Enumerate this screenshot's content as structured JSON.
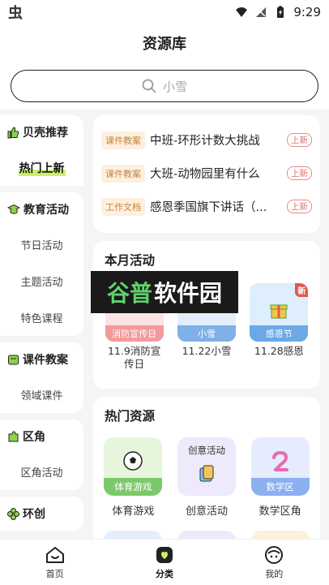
{
  "status_bar": {
    "app_glyph": "虫",
    "time": "9:29",
    "icons": [
      "wifi-icon",
      "signal-icon",
      "battery-icon"
    ]
  },
  "header": {
    "title": "资源库"
  },
  "search": {
    "placeholder": "小雪"
  },
  "sidebar": {
    "groups": [
      {
        "title": "贝壳推荐",
        "icon": "thumbs-up-icon",
        "items": [
          "热门上新"
        ],
        "active_index": 0
      },
      {
        "title": "教育活动",
        "icon": "graduation-cap-icon",
        "items": [
          "节日活动",
          "主题活动",
          "特色课程"
        ]
      },
      {
        "title": "课件教案",
        "icon": "courseware-icon",
        "items": [
          "领域课件"
        ]
      },
      {
        "title": "区角",
        "icon": "puzzle-icon",
        "items": [
          "区角活动"
        ]
      },
      {
        "title": "环创",
        "icon": "clover-icon",
        "items": []
      }
    ]
  },
  "recommend": {
    "items": [
      {
        "tag": "课件教案",
        "title": "中班-环形计数大挑战",
        "badge": "上新"
      },
      {
        "tag": "课件教案",
        "title": "大班-动物园里有什么",
        "badge": "上新"
      },
      {
        "tag": "工作文档",
        "title": "感恩季国旗下讲话（...",
        "badge": "上新"
      }
    ]
  },
  "monthly": {
    "title": "本月活动",
    "items": [
      {
        "band": "消防宣传日",
        "label": "11.9消防宣传日",
        "color": "#f29a9a",
        "bg": "#fde3e3"
      },
      {
        "band": "小雪",
        "label": "11.22小雪",
        "color": "#7fb0e8",
        "bg": "#e2eefc"
      },
      {
        "band": "感恩节",
        "label": "11.28感恩",
        "color": "#6aa8e6",
        "bg": "#dfeefd",
        "badge": "新"
      }
    ]
  },
  "hot": {
    "title": "热门资源",
    "items": [
      {
        "band": "体育游戏",
        "label": "体育游戏",
        "color": "#7cc96a",
        "bg": "#e6f6dc",
        "icon": "soccer-ball-icon"
      },
      {
        "band": "创意活动",
        "label": "创意活动",
        "color": "#b7a6e8",
        "bg": "#eee9fb",
        "icon": "paint-icon"
      },
      {
        "band": "数学区",
        "label": "数学区角",
        "color": "#8bb0f0",
        "bg": "#e4ecfd",
        "icon": "number-two-icon"
      }
    ]
  },
  "watermark": {
    "part1": "谷普",
    "part2": "软件园"
  },
  "bottom_nav": {
    "items": [
      {
        "label": "首页",
        "icon": "home-icon"
      },
      {
        "label": "分类",
        "icon": "category-icon",
        "active": true
      },
      {
        "label": "我的",
        "icon": "profile-icon"
      }
    ]
  },
  "colors": {
    "accent": "#c9f26a",
    "tag_text": "#c8843a",
    "new_badge": "#e06b6b"
  }
}
